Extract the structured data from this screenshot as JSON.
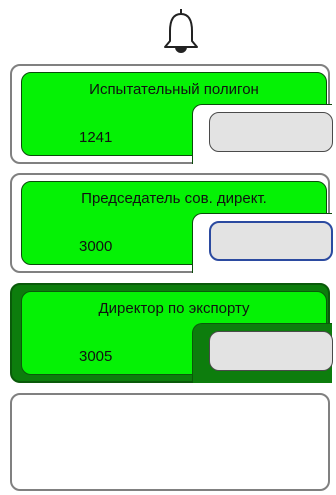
{
  "header": {
    "icon": "bell-icon"
  },
  "colors": {
    "panel_green": "#05f205",
    "active_card_bg": "#0d7d0d",
    "field_bg": "#e3e3e3",
    "focused_field_border": "#2b4aa0"
  },
  "cards": [
    {
      "title": "Испытательный полигон",
      "code": "1241",
      "state": "default",
      "input_value": ""
    },
    {
      "title": "Председатель сов. директ.",
      "code": "3000",
      "state": "focused",
      "input_value": ""
    },
    {
      "title": "Директор по экспорту",
      "code": "3005",
      "state": "active",
      "input_value": ""
    },
    {
      "title": "",
      "code": "",
      "state": "empty",
      "input_value": ""
    }
  ]
}
